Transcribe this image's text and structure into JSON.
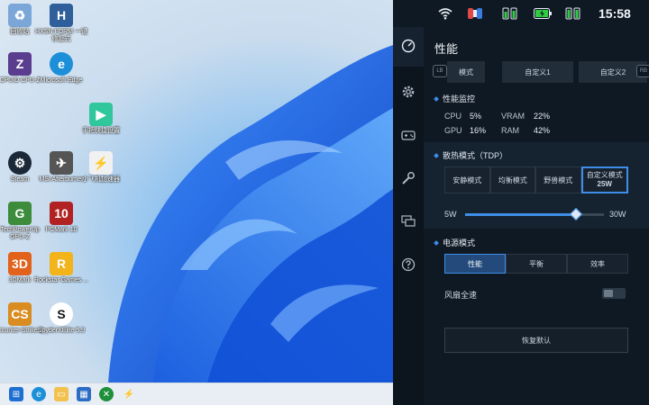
{
  "desktop": {
    "icons": [
      {
        "label": "回收站",
        "icon": "recycle-bin-icon",
        "color": "#7aa7d8"
      },
      {
        "label": "HXSN FORM 一键修复式",
        "icon": "hxsn-icon",
        "color": "#2e5f9a"
      },
      {
        "label": "CPUID CPU-Z",
        "icon": "cpuz-icon",
        "color": "#5a3d8f"
      },
      {
        "label": "Microsoft Edge",
        "icon": "edge-icon",
        "color": "#1c8fd8"
      },
      {
        "label": "手把快捷设置",
        "icon": "app-icon",
        "color": "#2fc79b"
      },
      {
        "label": "Steam",
        "icon": "steam-icon",
        "color": "#1b2838"
      },
      {
        "label": "MSI Afterburner",
        "icon": "msi-afterburner-icon",
        "color": "#555555"
      },
      {
        "label": "小飞机加速器",
        "icon": "accelerator-icon",
        "color": "#f1f1f1"
      },
      {
        "label": "TechPowerUp GPU-Z",
        "icon": "gpuz-icon",
        "color": "#3c8c3c"
      },
      {
        "label": "PCMark 10",
        "icon": "pcmark-icon",
        "color": "#b22222"
      },
      {
        "label": "3DMark",
        "icon": "3dmark-icon",
        "color": "#e2621b"
      },
      {
        "label": "Rockstar Games ...",
        "icon": "rockstar-icon",
        "color": "#f2b31b"
      },
      {
        "label": "Counter-Strike 2",
        "icon": "cs2-icon",
        "color": "#d98c1f"
      },
      {
        "label": "SpyderXElite 5.9",
        "icon": "spyder-icon",
        "color": "#ffffff"
      }
    ],
    "taskbar": [
      {
        "icon": "windows-start-icon",
        "color": "#1f6fd1"
      },
      {
        "icon": "edge-icon",
        "color": "#1c8fd8"
      },
      {
        "icon": "file-explorer-icon",
        "color": "#f2c14e"
      },
      {
        "icon": "store-icon",
        "color": "#2b6cc4"
      },
      {
        "icon": "xbox-icon",
        "color": "#1e8f3a"
      },
      {
        "icon": "app-icon",
        "color": "#333333"
      }
    ]
  },
  "status": {
    "time": "15:58"
  },
  "panel": {
    "title": "性能",
    "bumper_left": "LB",
    "bumper_right": "RB",
    "mode_tabs": [
      {
        "label": "模式",
        "active": false
      },
      {
        "label": "自定义1",
        "active": false
      },
      {
        "label": "自定义2",
        "active": false
      }
    ],
    "monitor": {
      "heading": "性能监控",
      "cpu_label": "CPU",
      "cpu_value": "5%",
      "vram_label": "VRAM",
      "vram_value": "22%",
      "gpu_label": "GPU",
      "gpu_value": "16%",
      "ram_label": "RAM",
      "ram_value": "42%"
    },
    "tdp": {
      "heading": "散热模式（TDP）",
      "options": [
        "安静模式",
        "均衡模式",
        "野兽模式"
      ],
      "custom_label": "自定义模式",
      "custom_value": "25W",
      "slider_min": "5W",
      "slider_max": "30W",
      "slider_fraction": 0.8
    },
    "power": {
      "heading": "电源模式",
      "options": [
        "性能",
        "平衡",
        "效率"
      ],
      "selected": 0
    },
    "fan": {
      "label": "风扇全速",
      "on": false
    },
    "reset_label": "恢复默认"
  },
  "colors": {
    "accent": "#3f8ee8",
    "battery_green": "#2ecc40"
  }
}
